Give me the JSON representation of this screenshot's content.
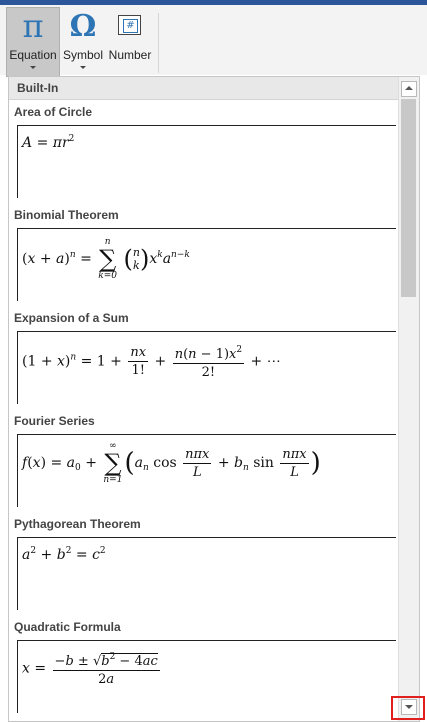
{
  "ribbon": {
    "equation_glyph": "π",
    "equation_label": "Equation",
    "symbol_glyph": "Ω",
    "symbol_label": "Symbol",
    "number_glyph": "#",
    "number_label": "Number"
  },
  "gallery": {
    "section_header": "Built-In",
    "entries": [
      {
        "title": "Area of Circle"
      },
      {
        "title": "Binomial Theorem"
      },
      {
        "title": "Expansion of a Sum"
      },
      {
        "title": "Fourier Series"
      },
      {
        "title": "Pythagorean Theorem"
      },
      {
        "title": "Quadratic Formula"
      }
    ]
  },
  "colors": {
    "accent": "#2b579a",
    "icon_blue": "#2e75b6",
    "highlight": "#e0201e"
  }
}
